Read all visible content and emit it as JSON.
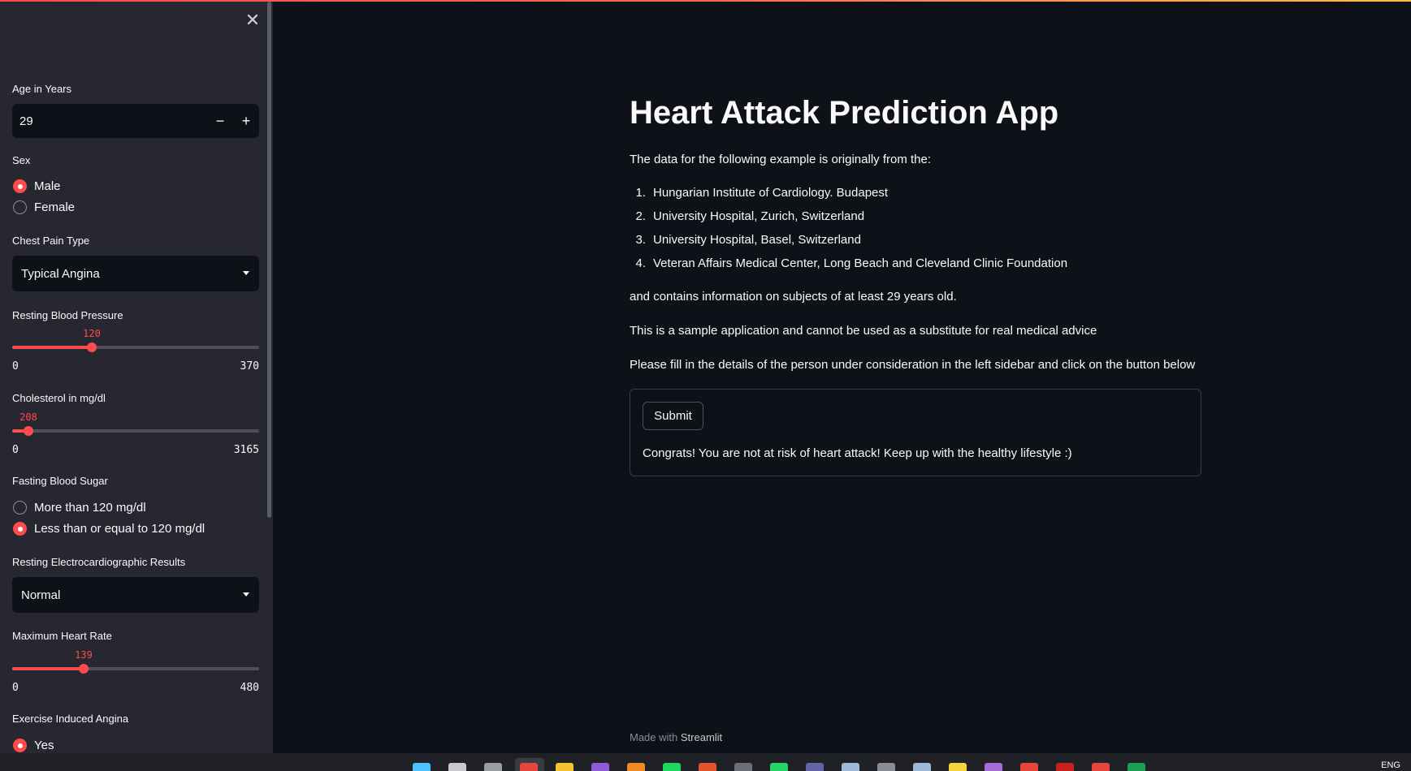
{
  "sidebar": {
    "age": {
      "label": "Age in Years",
      "value": "29",
      "minus": "−",
      "plus": "+"
    },
    "sex": {
      "label": "Sex",
      "options": [
        "Male",
        "Female"
      ],
      "selected": 0
    },
    "chest_pain": {
      "label": "Chest Pain Type",
      "value": "Typical Angina"
    },
    "resting_bp": {
      "label": "Resting Blood Pressure",
      "value": "120",
      "min": "0",
      "max": "370",
      "fraction": 0.324
    },
    "cholesterol": {
      "label": "Cholesterol in mg/dl",
      "value": "208",
      "min": "0",
      "max": "3165",
      "fraction": 0.066
    },
    "fasting_sugar": {
      "label": "Fasting Blood Sugar",
      "options": [
        "More than 120 mg/dl",
        "Less than or equal to 120 mg/dl"
      ],
      "selected": 1
    },
    "ecg": {
      "label": "Resting Electrocardiographic Results",
      "value": "Normal"
    },
    "max_hr": {
      "label": "Maximum Heart Rate",
      "value": "139",
      "min": "0",
      "max": "480",
      "fraction": 0.29
    },
    "angina": {
      "label": "Exercise Induced Angina",
      "options": [
        "Yes"
      ],
      "selected": 0
    }
  },
  "main": {
    "title": "Heart Attack Prediction App",
    "intro": "The data for the following example is originally from the:",
    "sources": [
      {
        "num": "1.",
        "text": "Hungarian Institute of Cardiology. Budapest"
      },
      {
        "num": "2.",
        "text": "University Hospital, Zurich, Switzerland"
      },
      {
        "num": "3.",
        "text": "University Hospital, Basel, Switzerland"
      },
      {
        "num": "4.",
        "text": "Veteran Affairs Medical Center, Long Beach and Cleveland Clinic Foundation"
      }
    ],
    "contains": "and contains information on subjects of at least 29 years old.",
    "disclaimer": "This is a sample application and cannot be used as a substitute for real medical advice",
    "instructions": "Please fill in the details of the person under consideration in the left sidebar and click on the button below",
    "submit_label": "Submit",
    "result": "Congrats! You are not at risk of heart attack! Keep up with the healthy lifestyle :)",
    "footer_prefix": "Made with",
    "footer_brand": "Streamlit"
  },
  "taskbar": {
    "lang": "ENG",
    "icons": [
      {
        "name": "windows-start-icon",
        "color": "#4cc2ff"
      },
      {
        "name": "search-icon",
        "color": "#c8c9ce"
      },
      {
        "name": "task-view-icon",
        "color": "#9a9ca4"
      },
      {
        "name": "chrome-icon",
        "color": "#e8453c"
      },
      {
        "name": "file-explorer-icon",
        "color": "#f4c430"
      },
      {
        "name": "visual-studio-icon",
        "color": "#8e5cd9"
      },
      {
        "name": "vlc-icon",
        "color": "#f08a24"
      },
      {
        "name": "spotify-icon",
        "color": "#1ed760"
      },
      {
        "name": "office-icon",
        "color": "#e2542c"
      },
      {
        "name": "app-icon",
        "color": "#6d6f78"
      },
      {
        "name": "whatsapp-icon",
        "color": "#25d366"
      },
      {
        "name": "teams-icon",
        "color": "#6264a7"
      },
      {
        "name": "photos-icon",
        "color": "#9fb9d8"
      },
      {
        "name": "keyboard-icon",
        "color": "#8b8d96"
      },
      {
        "name": "calculator-icon",
        "color": "#9fb9d8"
      },
      {
        "name": "sticky-notes-icon",
        "color": "#f6d33c"
      },
      {
        "name": "podcast-icon",
        "color": "#a56cd6"
      },
      {
        "name": "adobe-icon",
        "color": "#e8453c"
      },
      {
        "name": "acrobat-icon",
        "color": "#c8201d"
      },
      {
        "name": "adobe-reader-icon",
        "color": "#e8453c"
      },
      {
        "name": "excel-icon",
        "color": "#1f9d55"
      }
    ]
  }
}
